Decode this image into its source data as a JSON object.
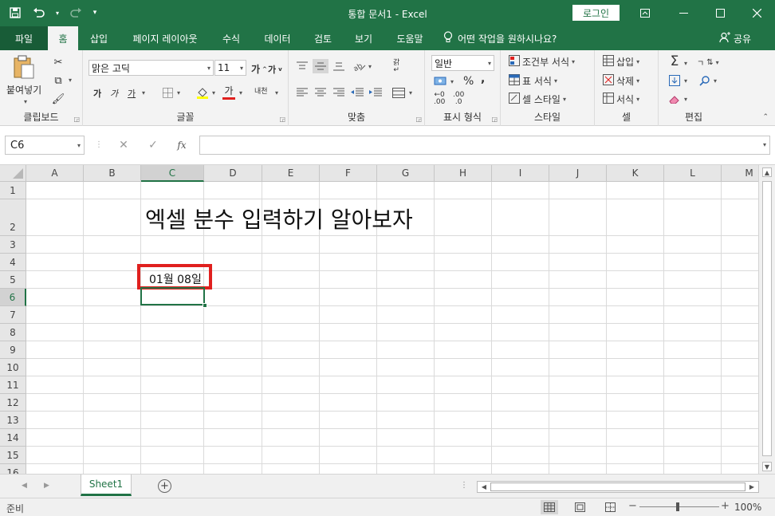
{
  "window": {
    "title": "통합 문서1  -  Excel",
    "login_label": "로그인",
    "qat_icons": [
      "save-icon",
      "undo-icon",
      "redo-icon",
      "customize-icon"
    ]
  },
  "tabs": {
    "file": "파일",
    "items": [
      "홈",
      "삽입",
      "페이지 레이아웃",
      "수식",
      "데이터",
      "검토",
      "보기",
      "도움말"
    ],
    "active": "홈",
    "tell_me": "어떤 작업을 원하시나요?",
    "share": "공유"
  },
  "ribbon": {
    "clipboard": {
      "label": "클립보드",
      "paste": "붙여넣기"
    },
    "font": {
      "label": "글꼴",
      "name": "맑은 고딕",
      "size": "11",
      "grow": "가",
      "shrink": "가",
      "bold": "가",
      "italic": "가",
      "underline": "가",
      "font_color": "가",
      "phonetic": "내천"
    },
    "alignment": {
      "label": "맞춤",
      "wrap": "갉"
    },
    "number": {
      "label": "표시 형식",
      "format": "일반",
      "percent": "%",
      "comma": ",",
      "inc_decimal": ".00",
      "dec_decimal": ".0"
    },
    "styles": {
      "label": "스타일",
      "conditional": "조건부 서식",
      "table": "표 서식",
      "cell": "셀 스타일"
    },
    "cells": {
      "label": "셀",
      "insert": "삽입",
      "delete": "삭제",
      "format": "서식"
    },
    "editing": {
      "label": "편집",
      "sort": "ㄱ"
    }
  },
  "formula_bar": {
    "name_box": "C6",
    "fx": "fx",
    "value": ""
  },
  "columns": [
    "A",
    "B",
    "C",
    "D",
    "E",
    "F",
    "G",
    "H",
    "I",
    "J",
    "K",
    "L",
    "M"
  ],
  "rows": [
    "1",
    "2",
    "3",
    "4",
    "5",
    "6",
    "7",
    "8",
    "9",
    "10",
    "11",
    "12",
    "13",
    "14",
    "15",
    "16"
  ],
  "selected_column": "C",
  "selected_row": "6",
  "cells": {
    "C2": "엑셀 분수 입력하기 알아보자",
    "C5": "01월 08일"
  },
  "sheet": {
    "name": "Sheet1"
  },
  "status": {
    "ready": "준비",
    "zoom": "100%",
    "zoom_level": 100
  },
  "colors": {
    "accent": "#217346",
    "highlight": "#e0201e"
  }
}
